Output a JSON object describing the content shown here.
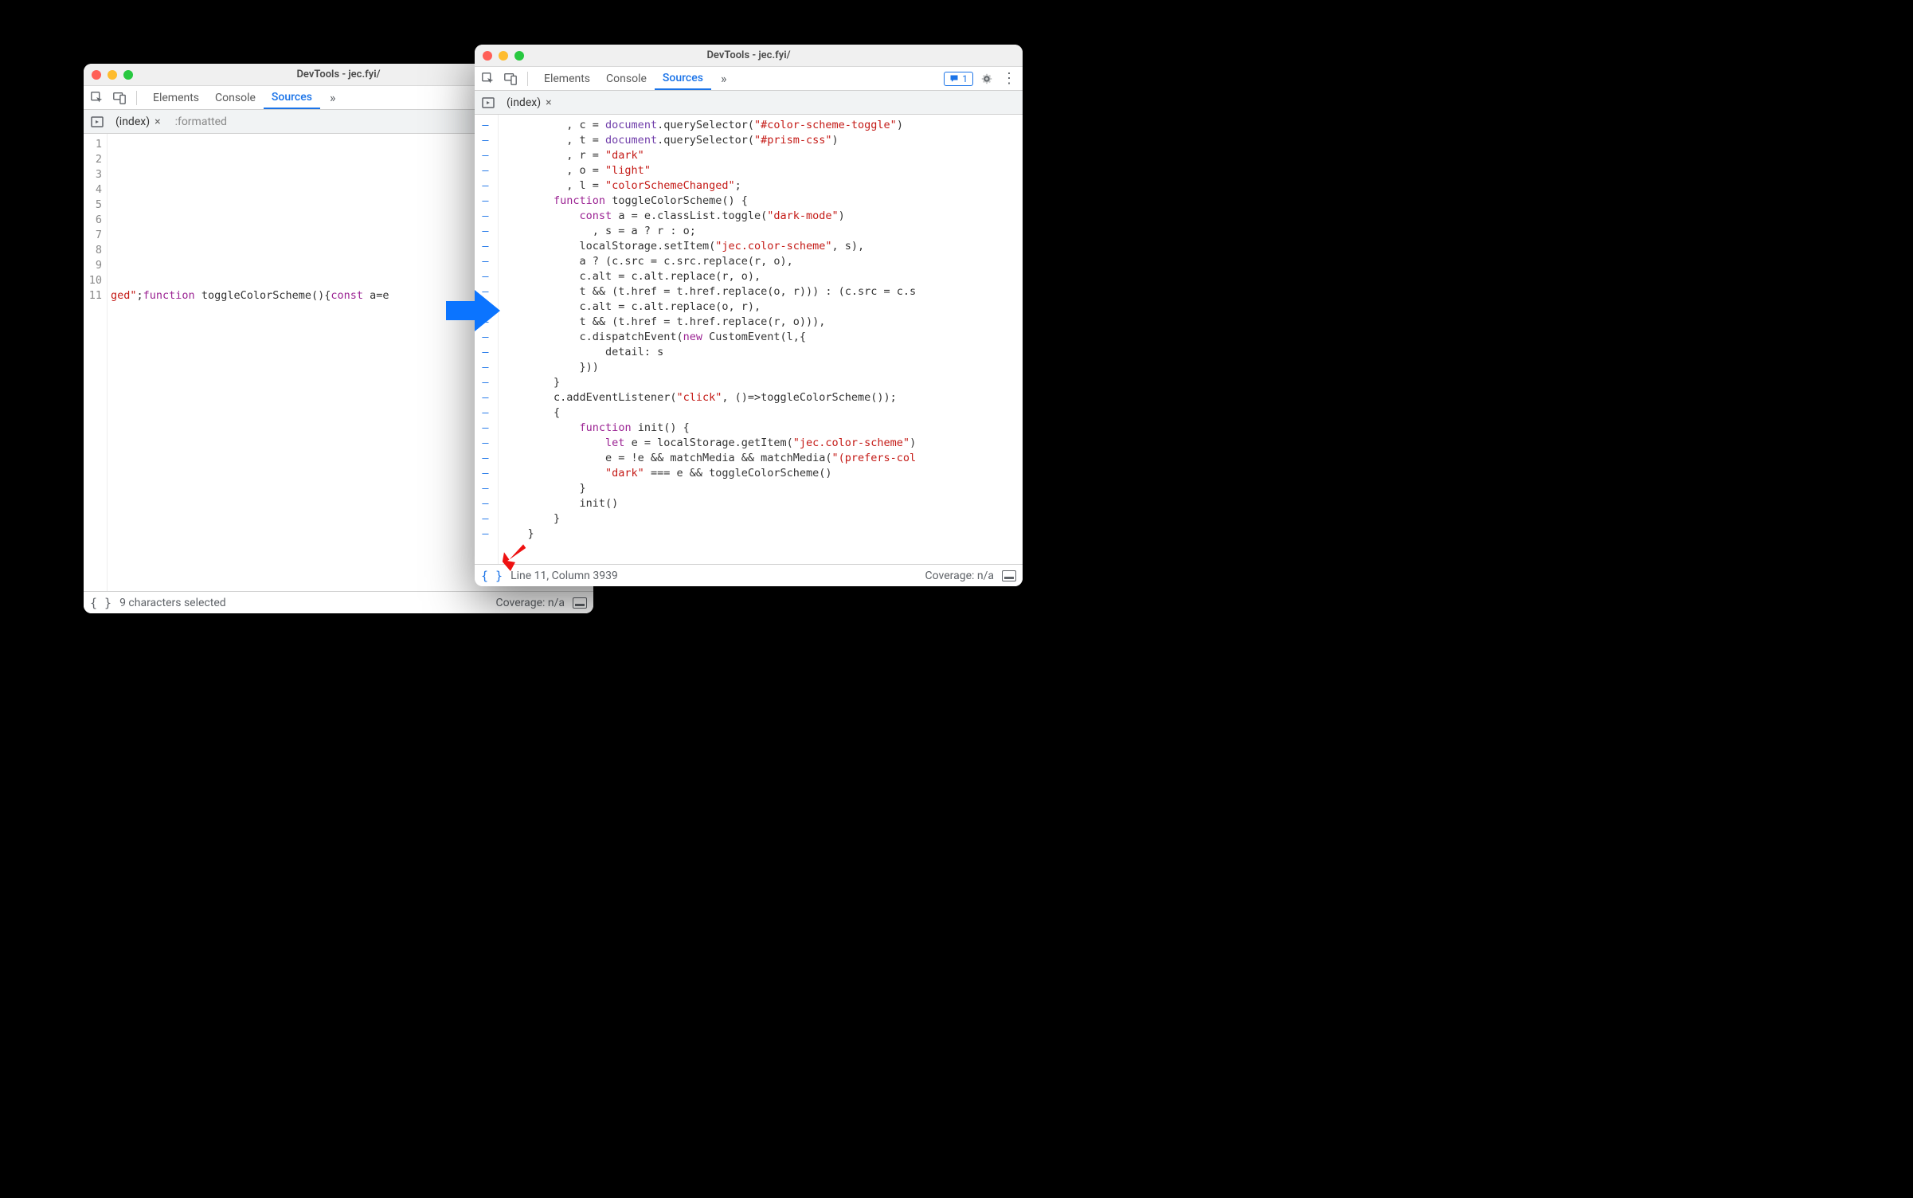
{
  "left_window": {
    "title": "DevTools - jec.fyi/",
    "toolbar_tabs": [
      "Elements",
      "Console",
      "Sources"
    ],
    "active_tab_index": 2,
    "file_tabs": [
      {
        "name": "(index)",
        "closable": true
      },
      {
        "name": ":formatted",
        "closable": false
      }
    ],
    "line_numbers": [
      "1",
      "2",
      "3",
      "4",
      "5",
      "6",
      "7",
      "8",
      "9",
      "10",
      "11"
    ],
    "code_line11": {
      "t0": "ged\"",
      "t1": ";",
      "kw_function": "function",
      "fname": " toggleColorScheme(){",
      "kw_const": "const",
      "rest": " a=e"
    },
    "status_left": "9 characters selected",
    "coverage": "Coverage: n/a"
  },
  "right_window": {
    "title": "DevTools - jec.fyi/",
    "toolbar_tabs": [
      "Elements",
      "Console",
      "Sources"
    ],
    "active_tab_index": 2,
    "badge_count": "1",
    "file_tab": "(index)",
    "code_lines": [
      {
        "indent": "          , ",
        "parts": [
          {
            "t": "c = ",
            "c": ""
          },
          {
            "t": "document",
            "c": "prop"
          },
          {
            "t": ".querySelector(",
            "c": ""
          },
          {
            "t": "\"#color-scheme-toggle\"",
            "c": "str"
          },
          {
            "t": ")",
            "c": ""
          }
        ]
      },
      {
        "indent": "          , ",
        "parts": [
          {
            "t": "t = ",
            "c": ""
          },
          {
            "t": "document",
            "c": "prop"
          },
          {
            "t": ".querySelector(",
            "c": ""
          },
          {
            "t": "\"#prism-css\"",
            "c": "str"
          },
          {
            "t": ")",
            "c": ""
          }
        ]
      },
      {
        "indent": "          , ",
        "parts": [
          {
            "t": "r = ",
            "c": ""
          },
          {
            "t": "\"dark\"",
            "c": "str"
          }
        ]
      },
      {
        "indent": "          , ",
        "parts": [
          {
            "t": "o = ",
            "c": ""
          },
          {
            "t": "\"light\"",
            "c": "str"
          }
        ]
      },
      {
        "indent": "          , ",
        "parts": [
          {
            "t": "l = ",
            "c": ""
          },
          {
            "t": "\"colorSchemeChanged\"",
            "c": "str"
          },
          {
            "t": ";",
            "c": ""
          }
        ]
      },
      {
        "indent": "        ",
        "parts": [
          {
            "t": "function",
            "c": "kw"
          },
          {
            "t": " toggleColorScheme() {",
            "c": ""
          }
        ]
      },
      {
        "indent": "            ",
        "parts": [
          {
            "t": "const",
            "c": "kw"
          },
          {
            "t": " a = e.classList.toggle(",
            "c": ""
          },
          {
            "t": "\"dark-mode\"",
            "c": "str"
          },
          {
            "t": ")",
            "c": ""
          }
        ]
      },
      {
        "indent": "              , ",
        "parts": [
          {
            "t": "s = a ? r : o;",
            "c": ""
          }
        ]
      },
      {
        "indent": "            ",
        "parts": [
          {
            "t": "localStorage.setItem(",
            "c": ""
          },
          {
            "t": "\"jec.color-scheme\"",
            "c": "str"
          },
          {
            "t": ", s),",
            "c": ""
          }
        ]
      },
      {
        "indent": "            ",
        "parts": [
          {
            "t": "a ? (c.src = c.src.replace(r, o),",
            "c": ""
          }
        ]
      },
      {
        "indent": "            ",
        "parts": [
          {
            "t": "c.alt = c.alt.replace(r, o),",
            "c": ""
          }
        ]
      },
      {
        "indent": "            ",
        "parts": [
          {
            "t": "t && (t.href = t.href.replace(o, r))) : (c.src = c.s",
            "c": ""
          }
        ]
      },
      {
        "indent": "            ",
        "parts": [
          {
            "t": "c.alt = c.alt.replace(o, r),",
            "c": ""
          }
        ]
      },
      {
        "indent": "            ",
        "parts": [
          {
            "t": "t && (t.href = t.href.replace(r, o))),",
            "c": ""
          }
        ]
      },
      {
        "indent": "            ",
        "parts": [
          {
            "t": "c.dispatchEvent(",
            "c": ""
          },
          {
            "t": "new",
            "c": "kw"
          },
          {
            "t": " CustomEvent(l,{",
            "c": ""
          }
        ]
      },
      {
        "indent": "                ",
        "parts": [
          {
            "t": "detail: s",
            "c": ""
          }
        ]
      },
      {
        "indent": "            ",
        "parts": [
          {
            "t": "}))",
            "c": ""
          }
        ]
      },
      {
        "indent": "        ",
        "parts": [
          {
            "t": "}",
            "c": ""
          }
        ]
      },
      {
        "indent": "        ",
        "parts": [
          {
            "t": "c.addEventListener(",
            "c": ""
          },
          {
            "t": "\"click\"",
            "c": "str"
          },
          {
            "t": ", ()=>toggleColorScheme());",
            "c": ""
          }
        ]
      },
      {
        "indent": "        ",
        "parts": [
          {
            "t": "{",
            "c": ""
          }
        ]
      },
      {
        "indent": "            ",
        "parts": [
          {
            "t": "function",
            "c": "kw"
          },
          {
            "t": " init() {",
            "c": ""
          }
        ]
      },
      {
        "indent": "                ",
        "parts": [
          {
            "t": "let",
            "c": "kw"
          },
          {
            "t": " e = localStorage.getItem(",
            "c": ""
          },
          {
            "t": "\"jec.color-scheme\"",
            "c": "str"
          },
          {
            "t": ")",
            "c": ""
          }
        ]
      },
      {
        "indent": "                ",
        "parts": [
          {
            "t": "e = !e && matchMedia && matchMedia(",
            "c": ""
          },
          {
            "t": "\"(prefers-col",
            "c": "str"
          }
        ]
      },
      {
        "indent": "                ",
        "parts": [
          {
            "t": "\"dark\"",
            "c": "str"
          },
          {
            "t": " === e && toggleColorScheme()",
            "c": ""
          }
        ]
      },
      {
        "indent": "            ",
        "parts": [
          {
            "t": "}",
            "c": ""
          }
        ]
      },
      {
        "indent": "            ",
        "parts": [
          {
            "t": "init()",
            "c": ""
          }
        ]
      },
      {
        "indent": "        ",
        "parts": [
          {
            "t": "}",
            "c": ""
          }
        ]
      },
      {
        "indent": "    ",
        "parts": [
          {
            "t": "}",
            "c": ""
          }
        ]
      }
    ],
    "status_left": "Line 11, Column 3939",
    "coverage": "Coverage: n/a"
  }
}
